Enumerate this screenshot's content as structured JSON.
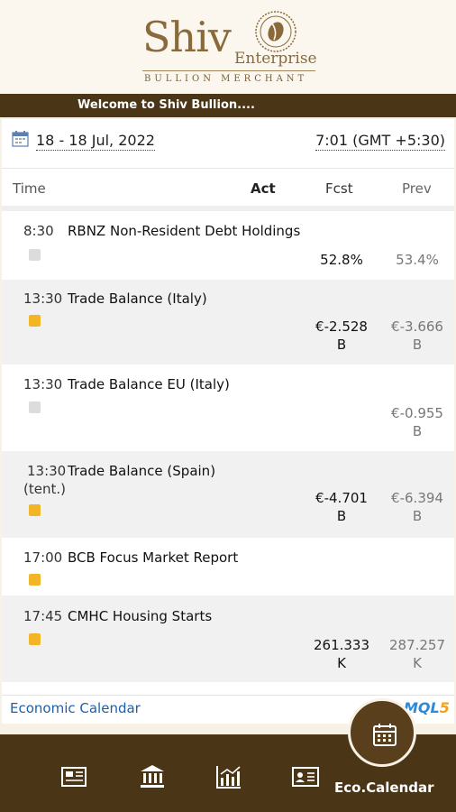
{
  "brand": {
    "name": "Shiv",
    "suffix": "Enterprise",
    "tagline": "BULLION MERCHANT"
  },
  "welcome": "Welcome to Shiv Bullion....",
  "calendar": {
    "date_range": "18 - 18 Jul, 2022",
    "time": "7:01 (GMT +5:30)",
    "columns": {
      "time": "Time",
      "act": "Act",
      "fcst": "Fcst",
      "prev": "Prev"
    },
    "events": [
      {
        "time": "8:30",
        "name": "RBNZ Non-Resident Debt Holdings",
        "importance": "low",
        "fcst": [
          "52.8%"
        ],
        "prev": [
          "53.4%"
        ]
      },
      {
        "time": "13:30",
        "name": "Trade Balance (Italy)",
        "importance": "medium",
        "fcst": [
          "€-2.528",
          "B"
        ],
        "prev": [
          "€-3.666",
          "B"
        ]
      },
      {
        "time": "13:30",
        "name": "Trade Balance EU (Italy)",
        "importance": "low",
        "fcst": [],
        "prev": [
          "€-0.955",
          "B"
        ]
      },
      {
        "time": "13:30",
        "tentative": "(tent.)",
        "name": "Trade Balance (Spain)",
        "importance": "medium",
        "fcst": [
          "€-4.701",
          "B"
        ],
        "prev": [
          "€-6.394",
          "B"
        ]
      },
      {
        "time": "17:00",
        "name": "BCB Focus Market Report",
        "importance": "medium",
        "fcst": [],
        "prev": []
      },
      {
        "time": "17:45",
        "name": "CMHC Housing Starts",
        "importance": "medium",
        "fcst": [
          "261.333",
          "K"
        ],
        "prev": [
          "287.257",
          "K"
        ]
      }
    ],
    "footer_link": "Economic Calendar",
    "provider": {
      "main": "MQL",
      "digit": "5"
    }
  },
  "nav": {
    "items": [
      {
        "icon": "newspaper-icon"
      },
      {
        "icon": "bank-icon"
      },
      {
        "icon": "chart-icon"
      },
      {
        "icon": "contact-card-icon"
      },
      {
        "icon": "calendar-icon",
        "label": "Eco.Calendar",
        "active": true
      }
    ]
  },
  "colors": {
    "brand_dark": "#4a3517",
    "gold": "#8a6a3a",
    "medium_importance": "#f2b526",
    "low_importance": "#dcdcdc",
    "link": "#1f5fa8"
  }
}
